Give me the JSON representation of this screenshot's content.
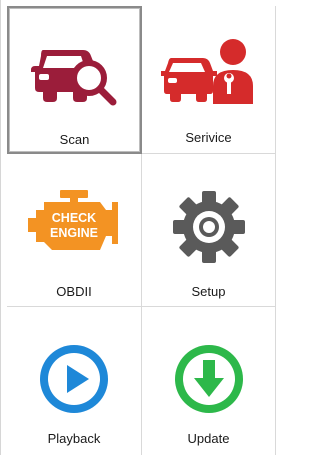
{
  "tiles": [
    {
      "id": "scan",
      "label": "Scan",
      "icon": "car-search-icon",
      "selected": true
    },
    {
      "id": "service",
      "label": "Serivice",
      "icon": "car-mechanic-icon",
      "selected": false
    },
    {
      "id": "obdii",
      "label": "OBDII",
      "icon": "check-engine-icon",
      "selected": false,
      "icon_text_line1": "CHECK",
      "icon_text_line2": "ENGINE"
    },
    {
      "id": "setup",
      "label": "Setup",
      "icon": "gear-icon",
      "selected": false
    },
    {
      "id": "playback",
      "label": "Playback",
      "icon": "play-icon",
      "selected": false
    },
    {
      "id": "update",
      "label": "Update",
      "icon": "download-arrow-icon",
      "selected": false
    }
  ],
  "colors": {
    "car_red": "#9b1d3a",
    "service_red": "#d52b2b",
    "engine_orange": "#f39323",
    "gear_gray": "#5a5a5a",
    "play_blue": "#1e88d8",
    "update_green": "#2db84a"
  }
}
